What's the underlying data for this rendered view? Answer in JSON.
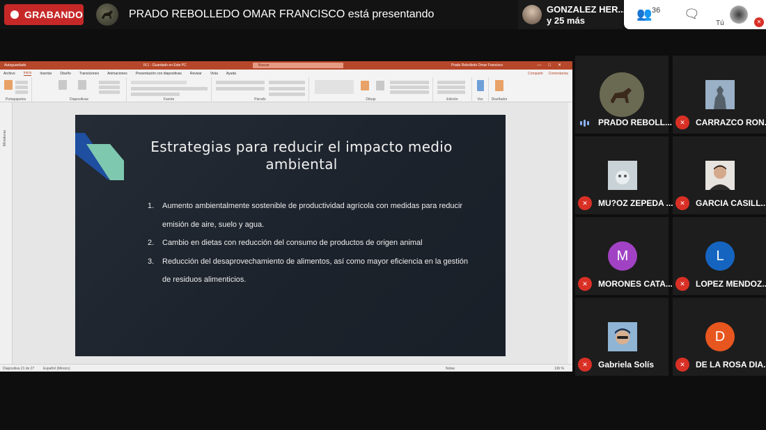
{
  "top": {
    "recording_label": "GRABANDO",
    "presenter_text": "PRADO REBOLLEDO OMAR FRANCISCO está presentando",
    "people_name": "GONZALEZ HER...",
    "people_more": "y 25 más",
    "participants_count": "36",
    "self_label": "Tú"
  },
  "ppt": {
    "autosave": "Autoguardado",
    "doc_title": "III.1 - Guardado en Este PC",
    "search_placeholder": "Buscar",
    "user": "Prado Rebolledo Omar Francisco",
    "menu": [
      "Archivo",
      "Inicio",
      "Insertar",
      "Diseño",
      "Transiciones",
      "Animaciones",
      "Presentación con diapositivas",
      "Revisar",
      "Vista",
      "Ayuda"
    ],
    "share": "Compartir",
    "comments": "Comentarios",
    "groups": [
      "Portapapeles",
      "Diapositivas",
      "Fuente",
      "Párrafo",
      "Dibujo",
      "Edición",
      "Voz",
      "Diseñador"
    ],
    "thumbnails_label": "Miniaturas",
    "status_slide": "Diapositiva 21 de 27",
    "status_lang": "Español (México)",
    "status_notes": "Notas",
    "status_zoom": "136 %"
  },
  "slide": {
    "title": "Estrategias para reducir el impacto medio ambiental",
    "items": [
      {
        "num": "1.",
        "text": "Aumento ambientalmente sostenible de productividad agrícola con medidas para reducir emisión de aire, suelo y agua."
      },
      {
        "num": "2.",
        "text": "Cambio en dietas con reducción del consumo de productos de origen animal"
      },
      {
        "num": "3.",
        "text": "Reducción del desaprovechamiento de alimentos, así como mayor eficiencia en la gestión de residuos alimenticios."
      }
    ]
  },
  "participants": [
    {
      "name": "PRADO REBOLL...",
      "initial": "",
      "color": "#5b5b4a",
      "muted": false
    },
    {
      "name": "CARRAZCO RON...",
      "initial": "",
      "color": "#7a8da0",
      "muted": true
    },
    {
      "name": "MU?OZ ZEPEDA ...",
      "initial": "",
      "color": "#b9c3c8",
      "muted": true
    },
    {
      "name": "GARCIA CASILL...",
      "initial": "",
      "color": "#c8a38a",
      "muted": true
    },
    {
      "name": "MORONES CATA...",
      "initial": "M",
      "color": "#a142c4",
      "muted": true
    },
    {
      "name": "LOPEZ MENDOZ...",
      "initial": "L",
      "color": "#1565c0",
      "muted": true
    },
    {
      "name": "Gabriela Solís",
      "initial": "",
      "color": "#7fa4c4",
      "muted": true
    },
    {
      "name": "DE LA ROSA DIA...",
      "initial": "D",
      "color": "#e8561f",
      "muted": true
    }
  ]
}
